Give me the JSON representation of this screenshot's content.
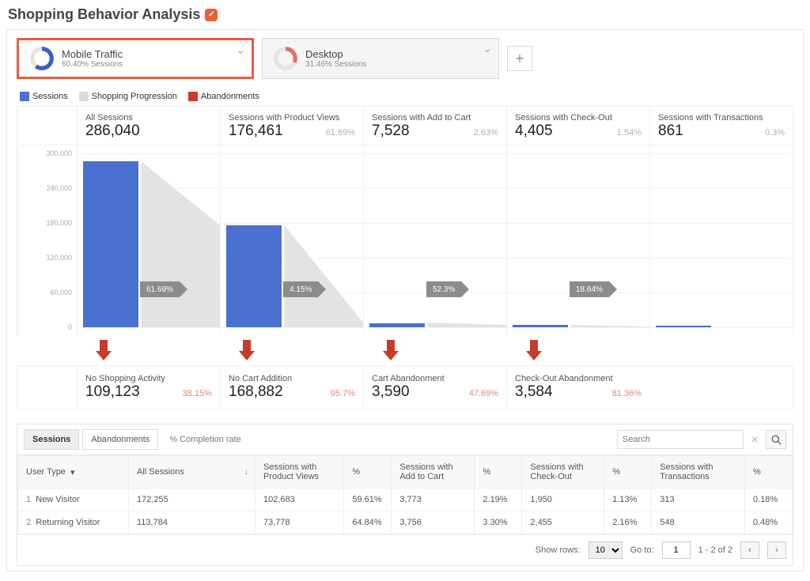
{
  "title": "Shopping Behavior Analysis",
  "segments": [
    {
      "title": "Mobile Traffic",
      "sub": "60.40% Sessions",
      "active": true
    },
    {
      "title": "Desktop",
      "sub": "31.46% Sessions",
      "active": false
    }
  ],
  "legend": {
    "sessions": "Sessions",
    "progression": "Shopping Progression",
    "abandonments": "Abandonments"
  },
  "columns": [
    {
      "label": "All Sessions",
      "value": "286,040",
      "pct": ""
    },
    {
      "label": "Sessions with Product Views",
      "value": "176,461",
      "pct": "61.69%"
    },
    {
      "label": "Sessions with Add to Cart",
      "value": "7,528",
      "pct": "2.63%"
    },
    {
      "label": "Sessions with Check-Out",
      "value": "4,405",
      "pct": "1.54%"
    },
    {
      "label": "Sessions with Transactions",
      "value": "861",
      "pct": "0.3%"
    }
  ],
  "progression": [
    "61.69%",
    "4.15%",
    "52.3%",
    "18.64%"
  ],
  "abandonments": [
    {
      "label": "No Shopping Activity",
      "value": "109,123",
      "pct": "38.15%"
    },
    {
      "label": "No Cart Addition",
      "value": "168,882",
      "pct": "95.7%"
    },
    {
      "label": "Cart Abandonment",
      "value": "3,590",
      "pct": "47.69%"
    },
    {
      "label": "Check-Out Abandonment",
      "value": "3,584",
      "pct": "81.36%"
    }
  ],
  "chart_data": {
    "type": "bar",
    "categories": [
      "All Sessions",
      "Sessions with Product Views",
      "Sessions with Add to Cart",
      "Sessions with Check-Out",
      "Sessions with Transactions"
    ],
    "values": [
      286040,
      176461,
      7528,
      4405,
      861
    ],
    "ylim": [
      0,
      300000
    ],
    "yticks": [
      0,
      60000,
      120000,
      180000,
      240000,
      300000
    ],
    "ytick_labels": [
      "0",
      "60,000",
      "120,000",
      "180,000",
      "240,000",
      "300,000"
    ],
    "progression_pct": [
      61.69,
      4.15,
      52.3,
      18.64
    ],
    "abandon_values": [
      109123,
      168882,
      3590,
      3584
    ],
    "abandon_pct": [
      38.15,
      95.7,
      47.69,
      81.36
    ],
    "legend": [
      "Sessions",
      "Shopping Progression",
      "Abandonments"
    ]
  },
  "tabs": {
    "t1": "Sessions",
    "t2": "Abandonments",
    "t3": "% Completion rate"
  },
  "search_placeholder": "Search",
  "table": {
    "headers": {
      "usertype": "User Type",
      "all": "All Sessions",
      "pv": "Sessions with Product Views",
      "pv_pct": "%",
      "atc": "Sessions with Add to Cart",
      "atc_pct": "%",
      "co": "Sessions with Check-Out",
      "co_pct": "%",
      "tx": "Sessions with Transactions",
      "tx_pct": "%"
    },
    "rows": [
      {
        "idx": "1",
        "type": "New Visitor",
        "all": "172,255",
        "pv": "102,683",
        "pv_pct": "59.61%",
        "atc": "3,773",
        "atc_pct": "2.19%",
        "co": "1,950",
        "co_pct": "1.13%",
        "tx": "313",
        "tx_pct": "0.18%"
      },
      {
        "idx": "2",
        "type": "Returning Visitor",
        "all": "113,784",
        "pv": "73,778",
        "pv_pct": "64.84%",
        "atc": "3,756",
        "atc_pct": "3.30%",
        "co": "2,455",
        "co_pct": "2.16%",
        "tx": "548",
        "tx_pct": "0.48%"
      }
    ]
  },
  "pager": {
    "show_rows_label": "Show rows:",
    "rows": "10",
    "goto_label": "Go to:",
    "goto": "1",
    "range": "1 - 2 of 2"
  }
}
